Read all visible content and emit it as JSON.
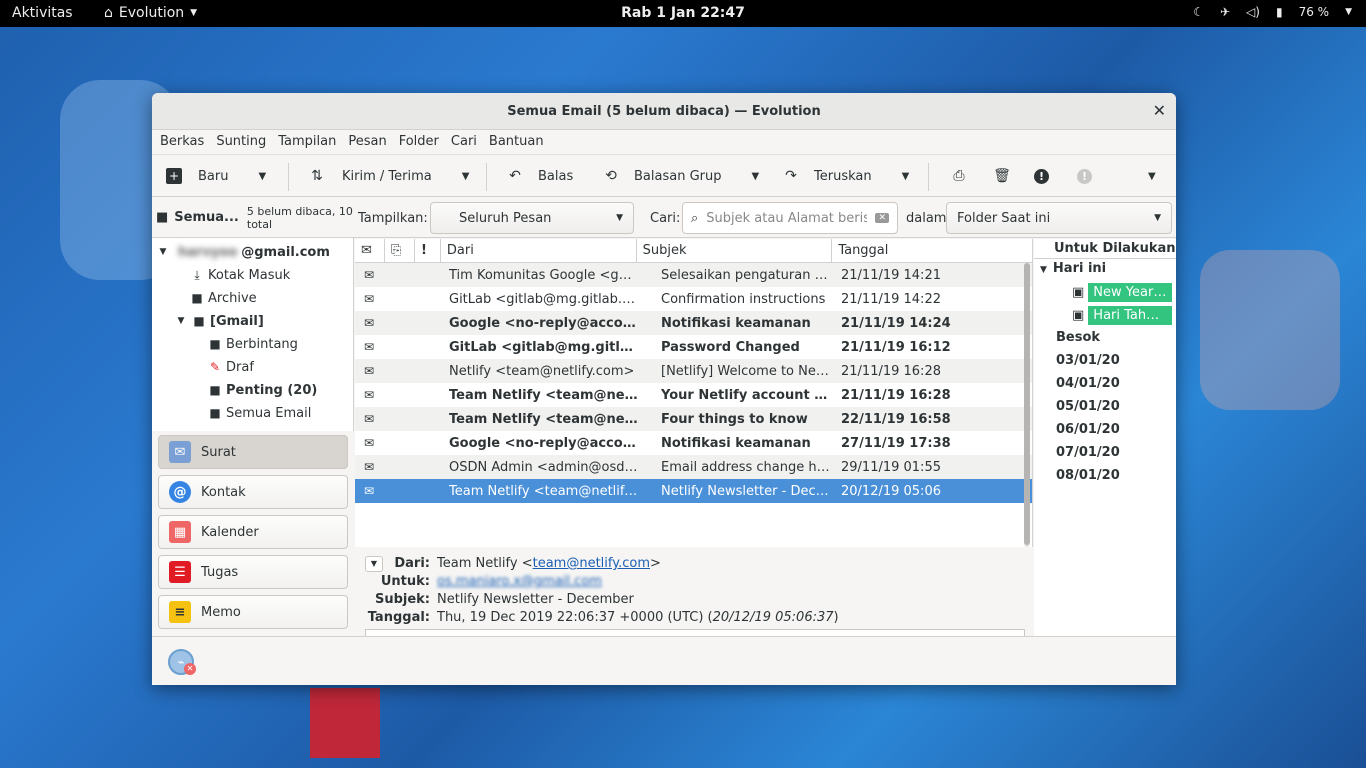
{
  "topbar": {
    "activities": "Aktivitas",
    "app": "Evolution",
    "clock": "Rab 1 Jan 22:47",
    "battery": "76 %"
  },
  "window": {
    "title": "Semua Email (5 belum dibaca) — Evolution"
  },
  "menu": [
    "Berkas",
    "Sunting",
    "Tampilan",
    "Pesan",
    "Folder",
    "Cari",
    "Bantuan"
  ],
  "toolbar": {
    "new": "Baru",
    "send_receive": "Kirim / Terima",
    "reply": "Balas",
    "reply_group": "Balasan Grup",
    "forward": "Teruskan"
  },
  "folder_header": {
    "name": "Semua...",
    "status": "5 belum dibaca, 10 total"
  },
  "folders": {
    "account_blur": "harvyoo",
    "account_domain": "@gmail.com",
    "inbox": "Kotak Masuk",
    "archive": "Archive",
    "gmail": "[Gmail]",
    "starred": "Berbintang",
    "drafts": "Draf",
    "important": "Penting (20)",
    "all": "Semua Email"
  },
  "nav": {
    "mail": "Surat",
    "contacts": "Kontak",
    "calendar": "Kalender",
    "tasks": "Tugas",
    "memos": "Memo"
  },
  "filter": {
    "show_label": "Tampilkan:",
    "show_value": "Seluruh Pesan",
    "search_label": "Cari:",
    "search_placeholder": "Subjek atau Alamat berisi",
    "in_label": "dalam",
    "scope_value": "Folder Saat ini"
  },
  "columns": {
    "from": "Dari",
    "subject": "Subjek",
    "date": "Tanggal"
  },
  "messages": [
    {
      "from": "Tim Komunitas Google <goo...",
      "subject": "Selesaikan pengaturan Aku...",
      "date": "21/11/19 14:21"
    },
    {
      "from": "GitLab <gitlab@mg.gitlab.co...",
      "subject": "Confirmation instructions",
      "date": "21/11/19 14:22"
    },
    {
      "from": "Google <no-reply@accounts...",
      "subject": "Notifikasi keamanan",
      "date": "21/11/19 14:24"
    },
    {
      "from": "GitLab <gitlab@mg.gitlab.c...",
      "subject": "Password Changed",
      "date": "21/11/19 16:12"
    },
    {
      "from": "Netlify <team@netlify.com>",
      "subject": "[Netlify] Welcome to Netli...",
      "date": "21/11/19 16:28"
    },
    {
      "from": "Team Netlify <team@netlify....",
      "subject": "Your Netlify account and h...",
      "date": "21/11/19 16:28"
    },
    {
      "from": "Team Netlify <team@netlify....",
      "subject": "Four things to know",
      "date": "22/11/19 16:58"
    },
    {
      "from": "Google <no-reply@accounts...",
      "subject": "Notifikasi keamanan",
      "date": "27/11/19 17:38"
    },
    {
      "from": "OSDN Admin <admin@osdn....",
      "subject": "Email address change has ...",
      "date": "29/11/19 01:55"
    },
    {
      "from": "Team Netlify <team@netlify....",
      "subject": "Netlify Newsletter - Decem...",
      "date": "20/12/19 05:06"
    }
  ],
  "preview": {
    "from_label": "Dari:",
    "from_name": "Team Netlify <",
    "from_email": "team@netlify.com",
    "from_end": ">",
    "to_label": "Untuk:",
    "to_email": "os.maniaro.x@gmail.com",
    "subject_label": "Subjek:",
    "subject": "Netlify Newsletter - December",
    "date_label": "Tanggal:",
    "date": "Thu, 19 Dec 2019 22:06:37 +0000 (UTC) (",
    "date_local": "20/12/19 05:06:37",
    "date_end": ")"
  },
  "todo": {
    "title": "Untuk Dilakukan",
    "today": "Hari ini",
    "events": [
      "New Year's...",
      "Hari Tahun ..."
    ],
    "tomorrow": "Besok",
    "dates": [
      "03/01/20",
      "04/01/20",
      "05/01/20",
      "06/01/20",
      "07/01/20",
      "08/01/20"
    ]
  }
}
